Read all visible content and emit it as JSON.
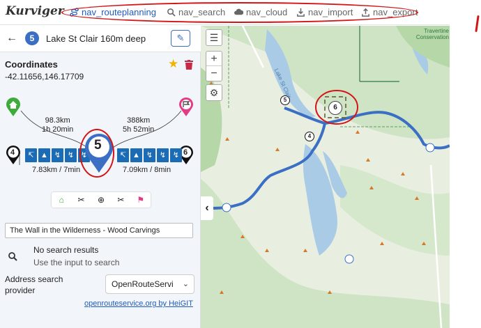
{
  "app": {
    "logo": "Kurviger"
  },
  "nav": {
    "items": [
      {
        "label": "nav_routeplanning",
        "icon": "route-icon",
        "active": true
      },
      {
        "label": "nav_search",
        "icon": "search-icon",
        "active": false
      },
      {
        "label": "nav_cloud",
        "icon": "cloud-icon",
        "active": false
      },
      {
        "label": "nav_import",
        "icon": "import-icon",
        "active": false
      },
      {
        "label": "nav_export",
        "icon": "export-icon",
        "active": false
      }
    ]
  },
  "sidebar": {
    "waypoint_number": "5",
    "title": "Lake St Clair 160m deep",
    "coordinates_label": "Coordinates",
    "coordinates_value": "-42.11656,146.17709",
    "route": {
      "total_left": "98.3km",
      "time_left": "1h 20min",
      "total_right": "388km",
      "time_right": "5h 52min",
      "prev_number": "4",
      "next_number": "6",
      "current_number": "5",
      "seg_left": "7.83km / 7min",
      "seg_right": "7.09km / 8min"
    },
    "search_value": "The Wall in the Wilderness - Wood Carvings",
    "no_results": "No search results",
    "no_results_hint": "Use the input to search",
    "provider_label": "Address search provider",
    "provider_value": "OpenRouteServi",
    "attribution": "openrouteservice.org by HeiGIT"
  },
  "map": {
    "markers": [
      "5",
      "6",
      "4"
    ],
    "area_label": "Travertine Conservation",
    "lake_label": "Lake St Clair"
  },
  "annotation": {
    "mark": "1"
  },
  "colors": {
    "accent": "#1f5bbf",
    "route": "#3a6fc4",
    "annotation": "#d41414",
    "map_green": "#cfe4c4",
    "water": "#a9cbe6"
  }
}
